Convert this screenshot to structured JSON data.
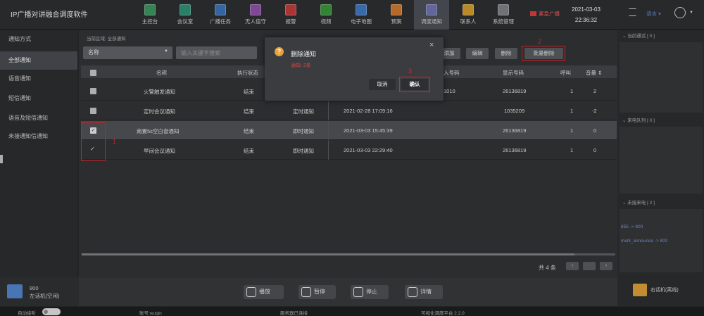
{
  "app": {
    "title": "IP广播对讲融合调度软件"
  },
  "nav": [
    {
      "label": "主控台",
      "icon": "dashboard-icon",
      "color": "#3b8f5c"
    },
    {
      "label": "会议室",
      "icon": "meeting-room-icon",
      "color": "#2e8a6f"
    },
    {
      "label": "广播任务",
      "icon": "broadcast-task-icon",
      "color": "#3b6fae"
    },
    {
      "label": "无人值守",
      "icon": "unattended-icon",
      "color": "#8a4fa0"
    },
    {
      "label": "报警",
      "icon": "alarm-icon",
      "color": "#b93a3a"
    },
    {
      "label": "视频",
      "icon": "video-icon",
      "color": "#3a8f3a"
    },
    {
      "label": "电子地图",
      "icon": "map-icon",
      "color": "#3d72b8"
    },
    {
      "label": "预案",
      "icon": "plan-icon",
      "color": "#c4732c"
    },
    {
      "label": "调度通知",
      "icon": "dispatch-notice-icon",
      "color": "#6b6fa8"
    },
    {
      "label": "联系人",
      "icon": "contacts-icon",
      "color": "#c9962c"
    },
    {
      "label": "系统管理",
      "icon": "system-admin-icon",
      "color": "#7a7d80"
    }
  ],
  "header": {
    "emergency": "紧急广播",
    "date": "2021-03-03",
    "time": "22:36:32",
    "lang": "语言"
  },
  "sidebar": {
    "heading": "通知方式",
    "items": [
      {
        "label": "全部通知"
      },
      {
        "label": "语音通知"
      },
      {
        "label": "短信通知"
      },
      {
        "label": "语音及短信通知"
      },
      {
        "label": "未接通知信通知"
      }
    ],
    "device": {
      "number": "800",
      "name": "左话机(空闲)"
    }
  },
  "main": {
    "area": "当前区域: 全部通知",
    "filter": {
      "value": "名称"
    },
    "search": {
      "placeholder": "输入关键字搜索"
    },
    "toolbar": {
      "add": "添加",
      "edit": "编辑",
      "delete": "删除",
      "batch_delete": "批量删除"
    },
    "annotations": {
      "one": "1",
      "two": "2",
      "three": "3"
    },
    "columns": [
      "名称",
      "执行状态",
      "入号码",
      "显示号码",
      "呼叫",
      "音量"
    ],
    "rows": [
      {
        "name": "火警触发通知",
        "status": "结束",
        "type": "",
        "time": "",
        "number": "1010",
        "display": "26136819",
        "calls": "1",
        "volume": "2",
        "checked": false
      },
      {
        "name": "定时会议通知",
        "status": "结束",
        "type": "定时通知",
        "time": "2021-02-28 17:09:16",
        "number": "",
        "display": "1035209",
        "calls": "1",
        "volume": "-2",
        "checked": false
      },
      {
        "name": "南置5s空白音通知",
        "status": "结束",
        "type": "即时通知",
        "time": "2021-03-03 15:45:39",
        "number": "",
        "display": "26136819",
        "calls": "1",
        "volume": "0",
        "checked": true
      },
      {
        "name": "早间会议通知",
        "status": "结束",
        "type": "即时通知",
        "time": "2021-03-03 22:29:40",
        "number": "",
        "display": "26136819",
        "calls": "1",
        "volume": "0",
        "checked": true
      }
    ],
    "pager": {
      "total": "共 4 条"
    },
    "bottom_buttons": {
      "play": "播放",
      "pause": "暂停",
      "stop": "停止",
      "detail": "详情"
    }
  },
  "right": {
    "current_call": "当前通话 [ 0 ]",
    "incoming_queue": "来电队列 [ 0 ]",
    "missed": "未接来电 [ 2 ]",
    "missed_items": [
      "855 -> 800",
      "multi_announce -> 800"
    ],
    "device_name": "右话机(离线)"
  },
  "status": {
    "auto_answer": "自动接听",
    "account": "账号:wuqin",
    "server": "服务器已连接",
    "platform": "可视化调度平台  2.2.0"
  },
  "modal": {
    "title": "删除通知",
    "message": "通知: 2条",
    "cancel": "取消",
    "confirm": "确认"
  }
}
